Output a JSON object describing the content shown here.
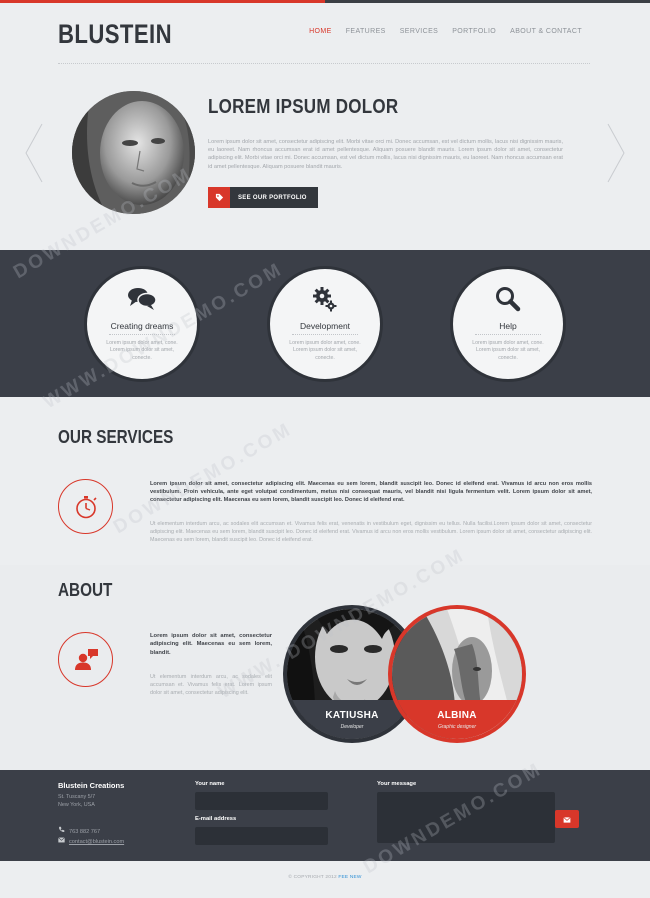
{
  "brand": "BLUSTEIN",
  "nav": [
    "HOME",
    "FEATURES",
    "SERVICES",
    "PORTFOLIO",
    "ABOUT & CONTACT"
  ],
  "hero": {
    "title": "LOREM IPSUM DOLOR",
    "text": "Lorem ipsum dolor sit amet, consectetur adipiscing elit. Morbi vitae orci mi. Donec accumsan, est vel dictum mollis, lacus nisi dignissim mauris, eu laoreet. Nam rhoncus accumsan erat id amet pellentesque. Aliquam posuere blandit mauris. Lorem ipsum dolor sit amet, consectetur adipiscing elit. Morbi vitae orci mi. Donec accumsan, est vel dictum mollis, lacus nisi dignissim mauris, eu laoreet. Nam rhoncus accumsan erat id amet pellentesque. Aliquam posuere blandit mauris.",
    "button": "SEE OUR PORTFOLIO"
  },
  "features": [
    {
      "icon": "chat-bubbles-icon",
      "title": "Creating dreams",
      "text": "Lorem ipsum dolor amet, cone. Lorem ipsum dolor sit amet, conecte."
    },
    {
      "icon": "gears-icon",
      "title": "Development",
      "text": "Lorem ipsum dolor amet, cone. Lorem ipsum dolor sit amet, conecte."
    },
    {
      "icon": "magnifier-icon",
      "title": "Help",
      "text": "Lorem ipsum dolor amet, cone. Lorem ipsum dolor sit amet, conecte."
    }
  ],
  "services": {
    "title": "OUR SERVICES",
    "bold": "Lorem ipsum dolor sit amet, consectetur adipiscing elit. Maecenas eu sem lorem, blandit suscipit leo. Donec id eleifend erat. Vivamus id arcu non eros mollis vestibulum. Proin vehicula, ante eget volutpat condimentum, metus nisi consequat mauris, vel blandit nisi ligula fermentum velit. Lorem ipsum dolor sit amet, consectetur adipiscing elit. Maecenas eu sem lorem, blandit suscipit leo. Donec id eleifend erat.",
    "light": "Ut elementum interdum arcu, ac sodales elit accumsan et. Vivamus felis erat, venenatis in vestibulum eget, dignissim eu tellus. Nulla facilisi.Lorem ipsum dolor sit amet, consectetur adipiscing elit. Maecenas eu sem lorem, blandit suscipit leo. Donec id eleifend erat. Vivamus id arcu non eros mollis vestibulum. Lorem ipsum dolor sit amet, consectetur adipiscing elit. Maecenas eu sem lorem, blandit suscipit leo. Donec id eleifend erat."
  },
  "about": {
    "title": "ABOUT",
    "bold": "Lorem ipsum dolor sit amet, consectetur adipiscing elit. Maecenas eu sem lorem, blandit.",
    "light": "Ut elementum interdum arcu, ac sodales elit accumsan et. Vivamus felis erat. Lorem ipsum dolor sit amet, consectetur adipiscing elit."
  },
  "team": [
    {
      "name": "KATIUSHA",
      "role": "Developer"
    },
    {
      "name": "ALBINA",
      "role": "Graphic designer"
    }
  ],
  "footer": {
    "company": "Blustein Creations",
    "address": [
      "St. Tuscany 5/7",
      "New York, USA"
    ],
    "phone": "763 882 767",
    "email": "contact@blustein.com",
    "name_label": "Your name",
    "email_label": "E-mail address",
    "message_label": "Your message",
    "copyright": "© COPYRIGHT 2012 ",
    "copyright_link": "FEE NEW"
  },
  "watermarks": [
    "DOWNDEMO.COM",
    "WWW.DOWNDEMO.COM",
    "WWW. DOWNDEMO.COM"
  ],
  "colors": {
    "accent": "#d8372a",
    "dark": "#3b3f48",
    "background": "#eceef0"
  }
}
